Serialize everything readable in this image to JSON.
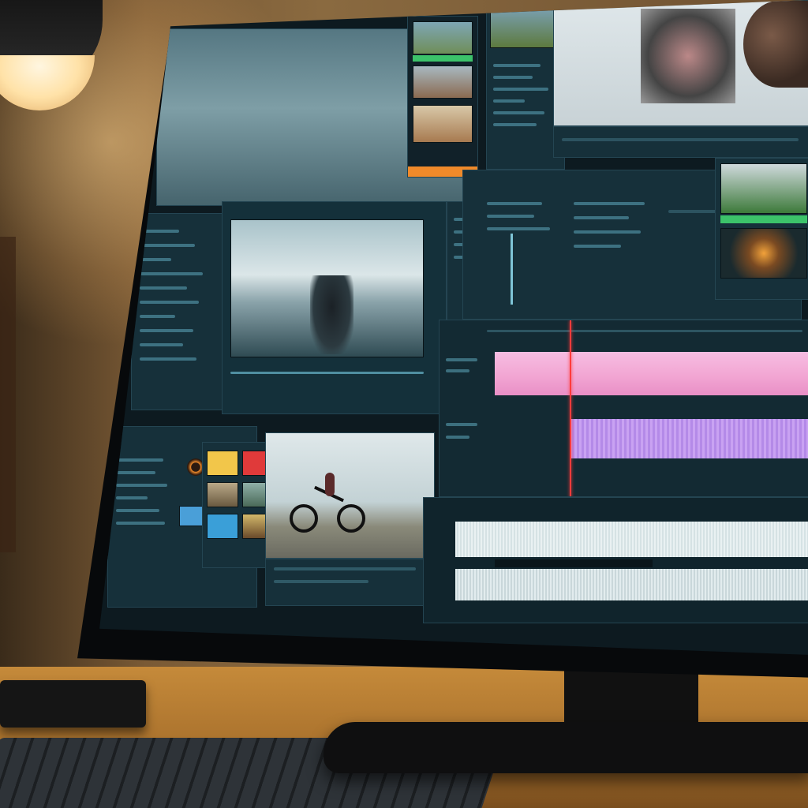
{
  "scene": {
    "description_colors": {
      "wall": "#8a6a40",
      "desk": "#c58a3a",
      "screen_bg": "#0d1a20",
      "panel_bg": "#16303a",
      "accent_cyan": "#5fa7bb",
      "track_pink": "#f2a6d3",
      "track_purple": "#c9a2f2",
      "playhead_red": "#ff3b3b",
      "highlight_orange": "#f08a2a",
      "highlight_green": "#3cc36a"
    }
  },
  "editor": {
    "icons": [
      "play-icon",
      "scissors-icon",
      "audio-icon",
      "folder-icon"
    ]
  }
}
